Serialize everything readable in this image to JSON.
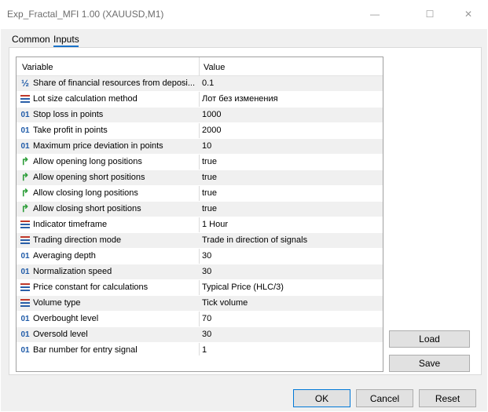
{
  "window": {
    "title": "Exp_Fractal_MFI 1.00 (XAUUSD,M1)",
    "minimize_glyph": "—",
    "maximize_glyph": "☐",
    "close_glyph": "✕"
  },
  "tabs": [
    {
      "label": "Common",
      "active": false
    },
    {
      "label": "Inputs",
      "active": true
    }
  ],
  "grid": {
    "headers": {
      "variable": "Variable",
      "value": "Value"
    },
    "rows": [
      {
        "icon": "fraction-icon",
        "glyph": "½",
        "variable": "Share of financial resources from deposi...",
        "value": "0.1"
      },
      {
        "icon": "enum-icon",
        "glyph": "",
        "variable": "Lot size calculation method",
        "value": "Лот без изменения"
      },
      {
        "icon": "integer-icon",
        "glyph": "01",
        "variable": "Stop loss in points",
        "value": "1000"
      },
      {
        "icon": "integer-icon",
        "glyph": "01",
        "variable": "Take profit in points",
        "value": "2000"
      },
      {
        "icon": "integer-icon",
        "glyph": "01",
        "variable": "Maximum price deviation in points",
        "value": "10"
      },
      {
        "icon": "bool-icon",
        "glyph": "↱",
        "variable": "Allow opening long positions",
        "value": "true"
      },
      {
        "icon": "bool-icon",
        "glyph": "↱",
        "variable": "Allow opening short positions",
        "value": "true"
      },
      {
        "icon": "bool-icon",
        "glyph": "↱",
        "variable": "Allow closing long positions",
        "value": "true"
      },
      {
        "icon": "bool-icon",
        "glyph": "↱",
        "variable": "Allow closing short positions",
        "value": "true"
      },
      {
        "icon": "enum-icon",
        "glyph": "",
        "variable": "Indicator timeframe",
        "value": "1 Hour"
      },
      {
        "icon": "enum-icon",
        "glyph": "",
        "variable": "Trading direction mode",
        "value": "Trade in direction of signals"
      },
      {
        "icon": "integer-icon",
        "glyph": "01",
        "variable": "Averaging depth",
        "value": "30"
      },
      {
        "icon": "integer-icon",
        "glyph": "01",
        "variable": "Normalization speed",
        "value": "30"
      },
      {
        "icon": "enum-icon",
        "glyph": "",
        "variable": "Price constant for calculations",
        "value": "Typical Price (HLC/3)"
      },
      {
        "icon": "enum-icon",
        "glyph": "",
        "variable": "Volume type",
        "value": "Tick volume"
      },
      {
        "icon": "integer-icon",
        "glyph": "01",
        "variable": "Overbought level",
        "value": "70"
      },
      {
        "icon": "integer-icon",
        "glyph": "01",
        "variable": "Oversold level",
        "value": "30"
      },
      {
        "icon": "integer-icon",
        "glyph": "01",
        "variable": "Bar number for entry signal",
        "value": "1"
      }
    ]
  },
  "side_buttons": {
    "load": "Load",
    "save": "Save"
  },
  "footer": {
    "ok": "OK",
    "cancel": "Cancel",
    "reset": "Reset"
  },
  "colors": {
    "integer_icon": "#1e5aa8",
    "bool_icon": "#2e9e3a",
    "enum_top": "#c0392b",
    "enum_bottom": "#2a5fa8",
    "tab_underline": "#1a73c9"
  }
}
